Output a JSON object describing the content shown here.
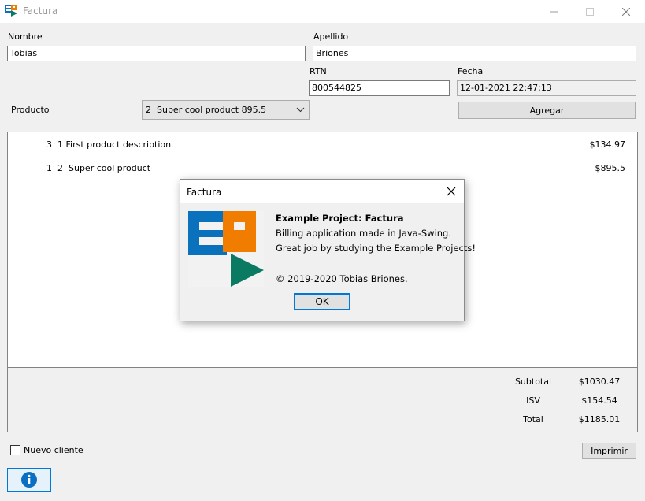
{
  "window": {
    "title": "Factura"
  },
  "form": {
    "nombre_label": "Nombre",
    "nombre_value": "Tobias",
    "apellido_label": "Apellido",
    "apellido_value": "Briones",
    "rtn_label": "RTN",
    "rtn_value": "800544825",
    "fecha_label": "Fecha",
    "fecha_value": "12-01-2021 22:47:13",
    "producto_label": "Producto",
    "producto_selected": "2  Super cool product 895.5",
    "agregar_label": "Agregar"
  },
  "items": [
    {
      "description": "3  1 First product description",
      "price": "$134.97"
    },
    {
      "description": "1  2  Super cool product",
      "price": "$895.5"
    }
  ],
  "totals": {
    "subtotal_label": "Subtotal",
    "subtotal_value": "$1030.47",
    "isv_label": "ISV",
    "isv_value": "$154.54",
    "total_label": "Total",
    "total_value": "$1185.01"
  },
  "footer": {
    "nuevo_cliente_label": "Nuevo cliente",
    "nuevo_cliente_checked": false,
    "imprimir_label": "Imprimir",
    "info_icon": "info-icon"
  },
  "dialog": {
    "title": "Factura",
    "heading": "Example Project: Factura",
    "line1": "Billing application made in Java-Swing.",
    "line2": "Great job by studying the Example Projects!",
    "copyright": "© 2019-2020 Tobias Briones.",
    "ok_label": "OK"
  },
  "colors": {
    "logo_blue": "#0a72bd",
    "logo_orange": "#f07c00",
    "logo_teal": "#0b7a63",
    "info_blue": "#0a6fc2",
    "focus_blue": "#0078d7"
  }
}
